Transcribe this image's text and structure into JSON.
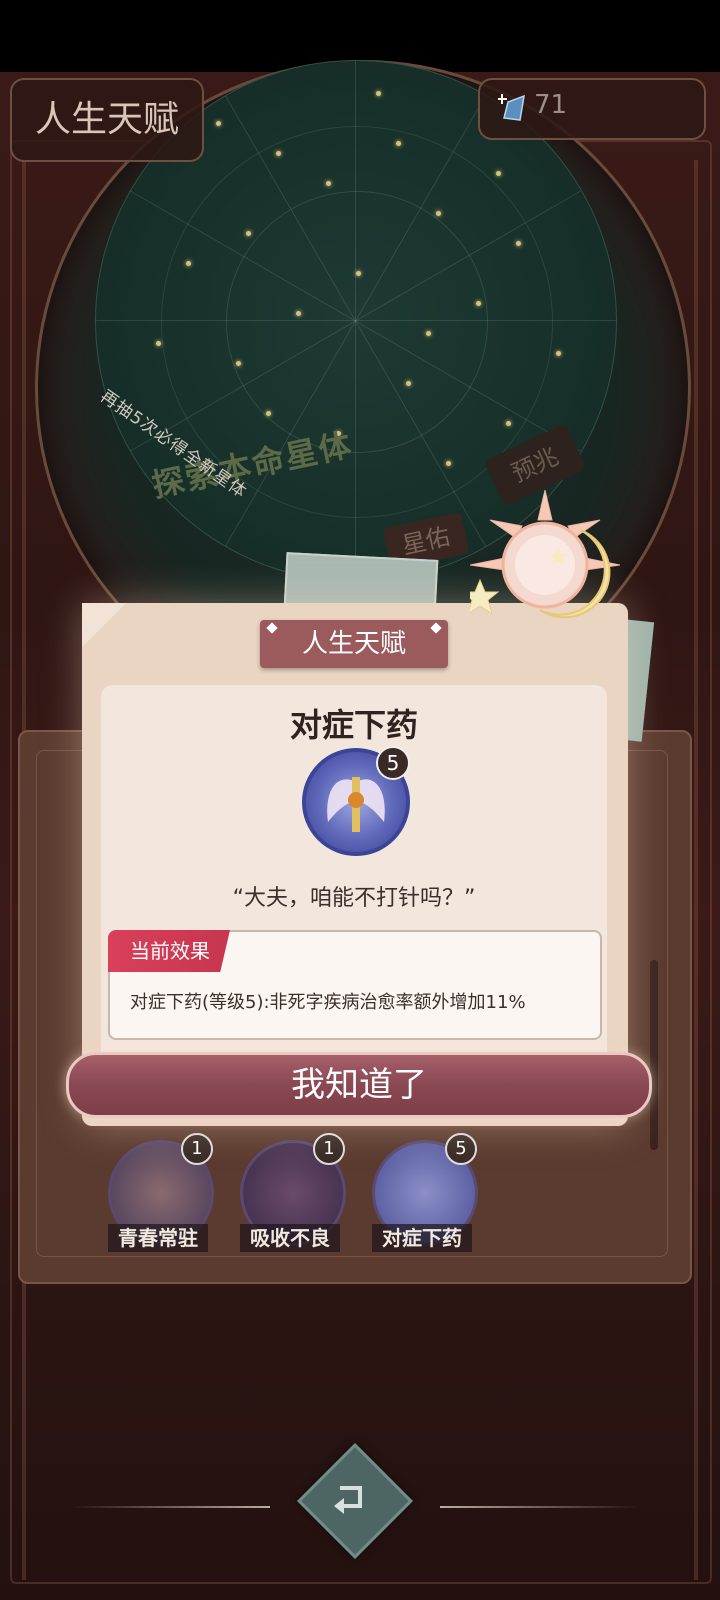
{
  "header": {
    "title": "人生天赋",
    "currency_value": "71"
  },
  "star_disc": {
    "title": "探索本命星体",
    "arc_text": "再抽5次必得全新星体",
    "tab_left": "星佑",
    "tab_right": "预兆"
  },
  "dialog": {
    "header": "人生天赋",
    "talent_name": "对症下药",
    "talent_level": "5",
    "quote": "“大夫，咱能不打针吗？”",
    "effect_tag": "当前效果",
    "effect_text": "对症下药(等级5):非死字疾病治愈率额外增加11%",
    "confirm_label": "我知道了"
  },
  "talents": [
    {
      "name": "青春常驻",
      "level": "1"
    },
    {
      "name": "吸收不良",
      "level": "1"
    },
    {
      "name": "对症下药",
      "level": "5"
    }
  ],
  "icons": {
    "currency": "crystal-icon",
    "back": "return-arrow-icon"
  }
}
